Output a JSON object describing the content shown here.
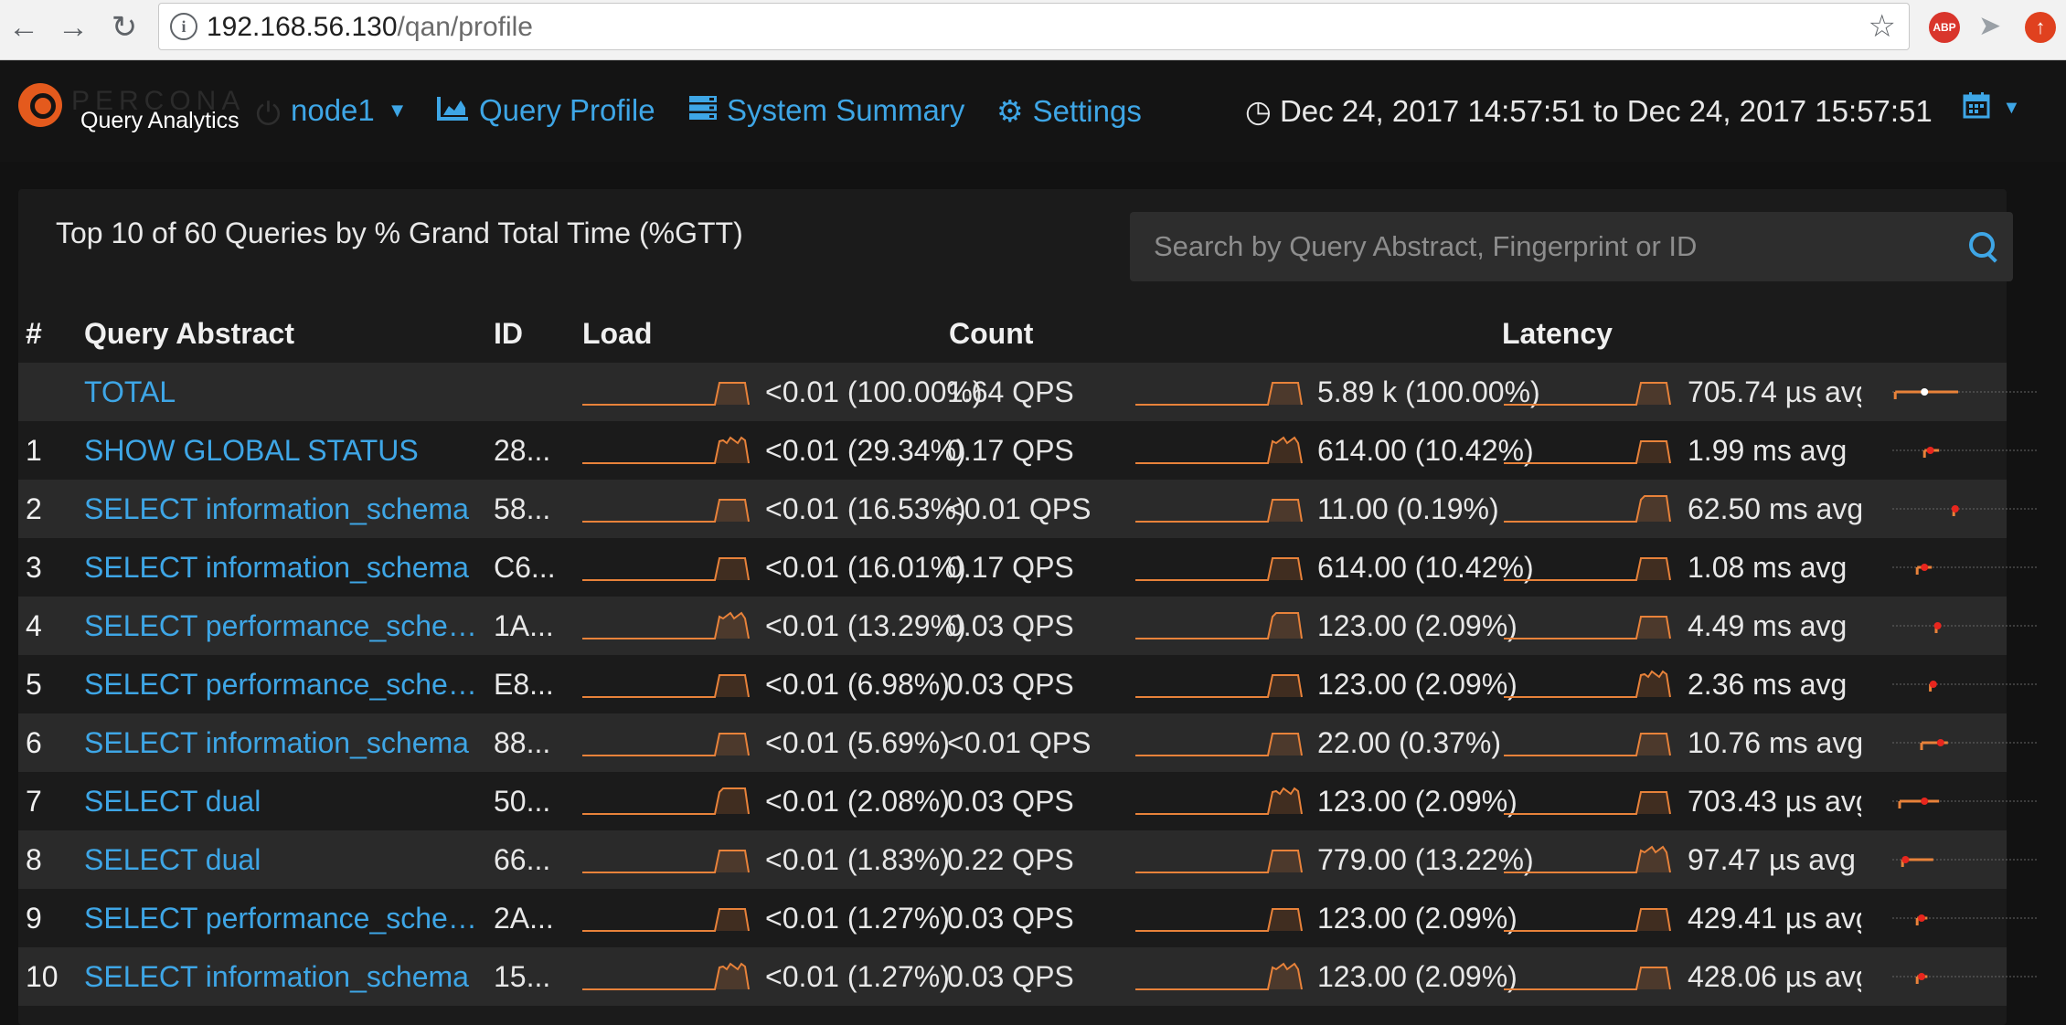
{
  "browser": {
    "url_host": "192.168.56.130",
    "url_path": "/qan/profile",
    "info_icon": "info-icon",
    "extensions": [
      {
        "name": "adblock-plus-icon",
        "label": "ABP"
      },
      {
        "name": "bird-icon"
      },
      {
        "name": "up-arrow-icon"
      }
    ]
  },
  "header": {
    "brand": "PERCONA",
    "subtitle": "Query Analytics",
    "node": "node1",
    "nav": {
      "profile": "Query Profile",
      "summary": "System Summary",
      "settings": "Settings"
    },
    "time_range": "Dec 24, 2017 14:57:51 to Dec 24, 2017 15:57:51"
  },
  "panel": {
    "title": "Top 10 of 60 Queries by % Grand Total Time (%GTT)",
    "search_placeholder": "Search by Query Abstract, Fingerprint or ID"
  },
  "table": {
    "headers": {
      "index": "#",
      "abstract": "Query Abstract",
      "id": "ID",
      "load": "Load",
      "count": "Count",
      "latency": "Latency"
    },
    "rows": [
      {
        "index": "",
        "abstract": "TOTAL",
        "id": "",
        "load": "<0.01 (100.00%)",
        "count_qps": "1.64 QPS",
        "count": "5.89 k (100.00%)",
        "latency": "705.74 µs avg",
        "lat_min": 0.02,
        "lat_med": 0.22,
        "lat_max": 0.45
      },
      {
        "index": "1",
        "abstract": "SHOW GLOBAL STATUS",
        "id": "28...",
        "load": "<0.01 (29.34%)",
        "count_qps": "0.17 QPS",
        "count": "614.00 (10.42%)",
        "latency": "1.99 ms avg",
        "lat_min": 0.22,
        "lat_med": 0.26,
        "lat_max": 0.32
      },
      {
        "index": "2",
        "abstract": "SELECT information_schema",
        "id": "58...",
        "load": "<0.01 (16.53%)",
        "count_qps": "<0.01 QPS",
        "count": "11.00 (0.19%)",
        "latency": "62.50 ms avg",
        "lat_min": 0.42,
        "lat_med": 0.43,
        "lat_max": 0.44
      },
      {
        "index": "3",
        "abstract": "SELECT information_schema",
        "id": "C6...",
        "load": "<0.01 (16.01%)",
        "count_qps": "0.17 QPS",
        "count": "614.00 (10.42%)",
        "latency": "1.08 ms avg",
        "lat_min": 0.17,
        "lat_med": 0.22,
        "lat_max": 0.27
      },
      {
        "index": "4",
        "abstract": "SELECT performance_schema",
        "id": "1A...",
        "load": "<0.01 (13.29%)",
        "count_qps": "0.03 QPS",
        "count": "123.00 (2.09%)",
        "latency": "4.49 ms avg",
        "lat_min": 0.3,
        "lat_med": 0.31,
        "lat_max": 0.33
      },
      {
        "index": "5",
        "abstract": "SELECT performance_schema",
        "id": "E8...",
        "load": "<0.01 (6.98%)",
        "count_qps": "0.03 QPS",
        "count": "123.00 (2.09%)",
        "latency": "2.36 ms avg",
        "lat_min": 0.26,
        "lat_med": 0.28,
        "lat_max": 0.3
      },
      {
        "index": "6",
        "abstract": "SELECT information_schema",
        "id": "88...",
        "load": "<0.01 (5.69%)",
        "count_qps": "<0.01 QPS",
        "count": "22.00 (0.37%)",
        "latency": "10.76 ms avg",
        "lat_min": 0.2,
        "lat_med": 0.33,
        "lat_max": 0.38
      },
      {
        "index": "7",
        "abstract": "SELECT dual",
        "id": "50...",
        "load": "<0.01 (2.08%)",
        "count_qps": "0.03 QPS",
        "count": "123.00 (2.09%)",
        "latency": "703.43 µs avg",
        "lat_min": 0.05,
        "lat_med": 0.22,
        "lat_max": 0.32
      },
      {
        "index": "8",
        "abstract": "SELECT dual",
        "id": "66...",
        "load": "<0.01 (1.83%)",
        "count_qps": "0.22 QPS",
        "count": "779.00 (13.22%)",
        "latency": "97.47 µs avg",
        "lat_min": 0.07,
        "lat_med": 0.09,
        "lat_max": 0.28
      },
      {
        "index": "9",
        "abstract": "SELECT performance_schema",
        "id": "2A...",
        "load": "<0.01 (1.27%)",
        "count_qps": "0.03 QPS",
        "count": "123.00 (2.09%)",
        "latency": "429.41 µs avg",
        "lat_min": 0.17,
        "lat_med": 0.2,
        "lat_max": 0.24
      },
      {
        "index": "10",
        "abstract": "SELECT information_schema",
        "id": "15...",
        "load": "<0.01 (1.27%)",
        "count_qps": "0.03 QPS",
        "count": "123.00 (2.09%)",
        "latency": "428.06 µs avg",
        "lat_min": 0.17,
        "lat_med": 0.2,
        "lat_max": 0.24
      }
    ]
  },
  "colors": {
    "accent": "#3ea6e6",
    "spark": "#e8823a",
    "marker": "#e8261e",
    "row_even": "#2a2a2a",
    "row_odd": "#1b1b1b"
  }
}
